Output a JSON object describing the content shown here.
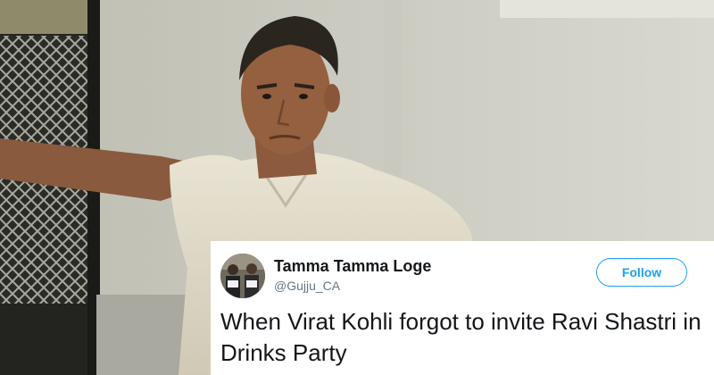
{
  "photo": {
    "icon": "photo-of-man-on-train"
  },
  "tweet": {
    "display_name": "Tamma Tamma Loge",
    "handle": "@Gujju_CA",
    "follow_label": "Follow",
    "text": "When Virat Kohli forgot to invite Ravi Shastri in Drinks Party",
    "avatar_icon": "profile-avatar",
    "accent_color": "#1da1f2"
  }
}
